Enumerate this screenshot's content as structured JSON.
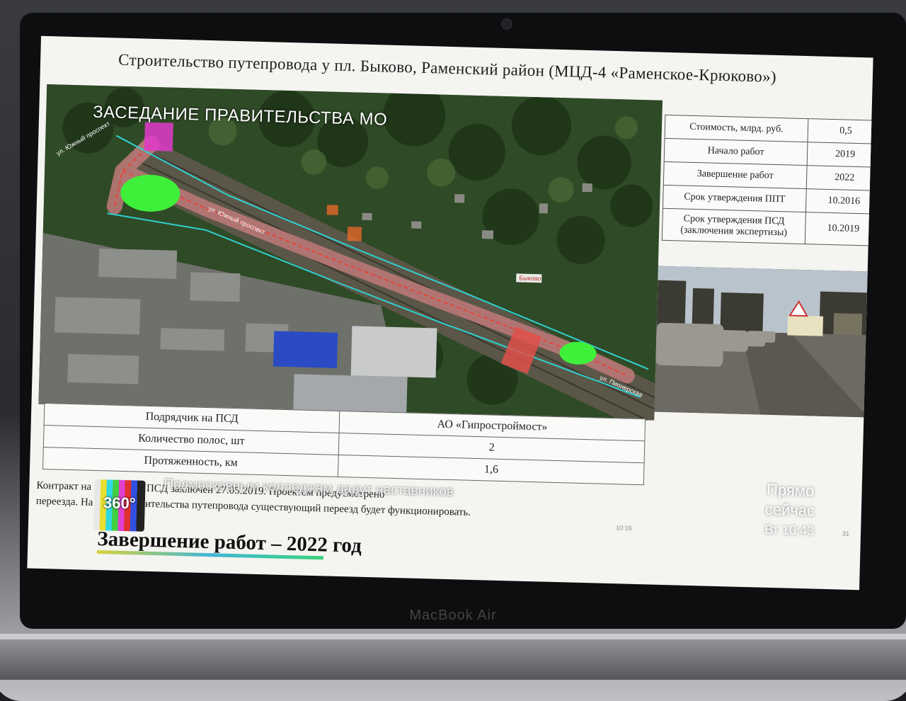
{
  "laptop": {
    "brand": "MacBook Air"
  },
  "slide": {
    "title": "Строительство путепровода у пл. Быково, Раменский район (МЦД-4 «Раменское-Крюково»)",
    "overlay_caption": "ЗАСЕДАНИЕ ПРАВИТЕЛЬСТВА МО",
    "map_labels": {
      "station": "Быково",
      "street_1": "ул. Южный проспект",
      "street_2": "ул. Южный проспект",
      "street_3": "ул. Пионерская"
    },
    "info_table": [
      {
        "label": "Стоимость, млрд. руб.",
        "value": "0,5"
      },
      {
        "label": "Начало работ",
        "value": "2019"
      },
      {
        "label": "Завершение работ",
        "value": "2022"
      },
      {
        "label": "Срок утверждения ППТ",
        "value": "10.2016"
      },
      {
        "label": "Срок утверждения ПСД (заключения экспертизы)",
        "value": "10.2019"
      }
    ],
    "bottom_table": [
      {
        "label": "Подрядчик на ПСД",
        "value": "АО «Гипростроймост»"
      },
      {
        "label": "Количество полос, шт",
        "value": "2"
      },
      {
        "label": "Протяженность, км",
        "value": "1,6"
      }
    ],
    "note_line_1": "Контракт на разработку ПСД заключен 27.05.2019. Проектом предусмотрено",
    "note_line_2": "переезда. На время строительства путепровода существующий переезд будет функционировать.",
    "completion": "Завершение работ – 2022 год",
    "slide_time": "10:16",
    "page_number": "31"
  },
  "tv": {
    "channel_logo": "360°",
    "ticker": "Подмосковным колледжам дадут наставников",
    "live_label_1": "Прямо",
    "live_label_2": "сейчас",
    "live_day": "Вт",
    "live_time": "10:43"
  }
}
